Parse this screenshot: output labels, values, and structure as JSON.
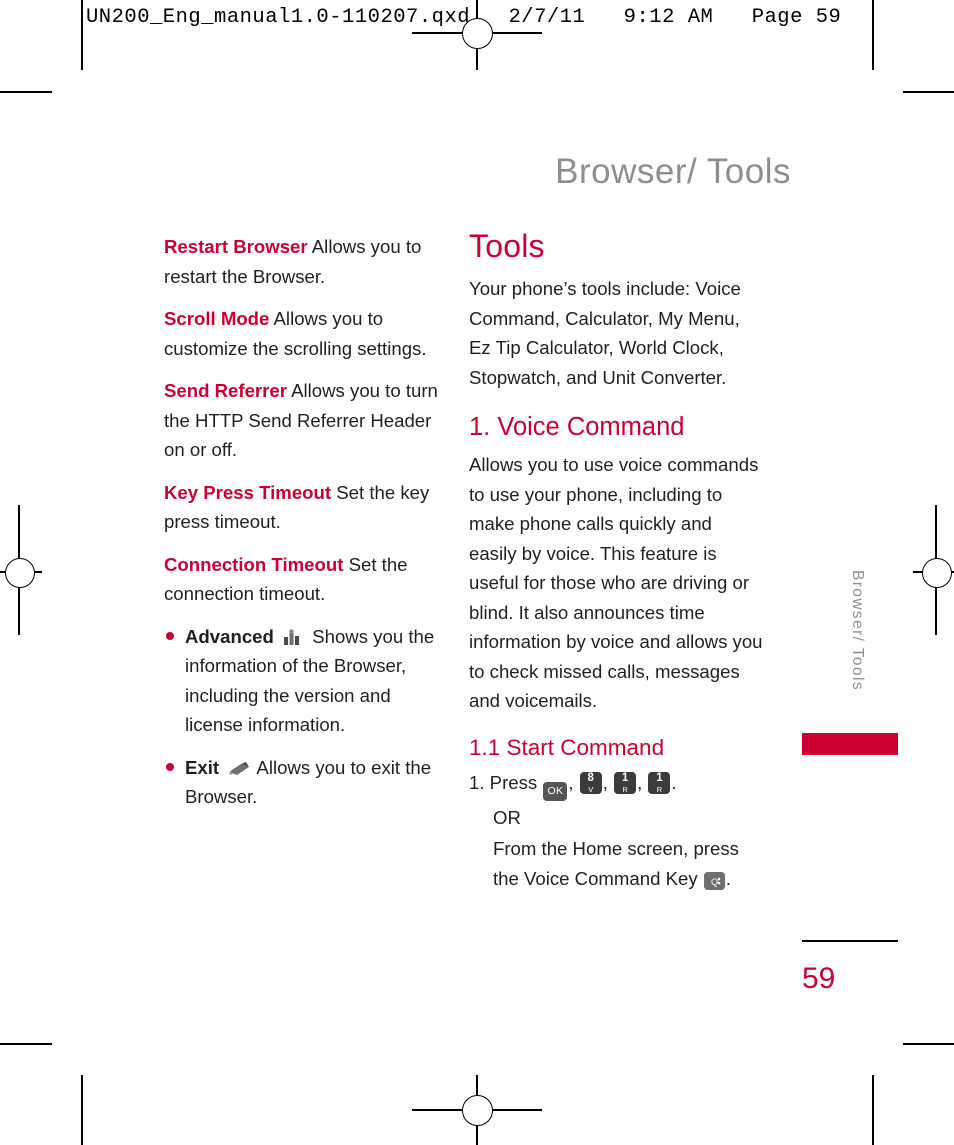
{
  "header": {
    "strip_text": "UN200_Eng_manual1.0-110207.qxd   2/7/11   9:12 AM   Page 59"
  },
  "chapter": {
    "title": "Browser/ Tools",
    "side_tab_label": "Browser/ Tools",
    "page_number": "59"
  },
  "left_column": {
    "entries": [
      {
        "term": "Restart Browser",
        "text": " Allows you to restart the Browser."
      },
      {
        "term": "Scroll Mode",
        "text": " Allows you to customize the scrolling settings."
      },
      {
        "term": "Send Referrer",
        "text": " Allows you to turn the HTTP Send Referrer Header on or off."
      },
      {
        "term": "Key Press Timeout",
        "text": " Set the key press timeout."
      },
      {
        "term": "Connection Timeout",
        "text": " Set the connection timeout."
      }
    ],
    "bullets": [
      {
        "term": "Advanced",
        "icon": "advanced-gear-icon",
        "text": " Shows you the information of the Browser, including the version and license information."
      },
      {
        "term": "Exit",
        "icon": "exit-arrow-icon",
        "text": " Allows you to exit the Browser."
      }
    ]
  },
  "right_column": {
    "tools_heading": "Tools",
    "tools_intro": "Your phone’s tools include: Voice Command, Calculator, My Menu, Ez Tip Calculator, World Clock, Stopwatch, and Unit Converter.",
    "voice_command_heading": "1. Voice Command",
    "voice_command_body": "Allows you to use voice commands to use your phone, including to make phone calls quickly and easily by voice. This feature is useful for those who are driving or blind. It also announces time information by voice and allows you to check missed calls, messages and voicemails.",
    "start_command_heading": "1.1 Start Command",
    "steps": [
      {
        "prefix": "1. Press",
        "keys": [
          "OK",
          "8",
          "1",
          "1"
        ],
        "key_sublabels": [
          "",
          "V",
          "R",
          "R"
        ],
        "suffix": "."
      },
      {
        "text": "OR"
      },
      {
        "text": "From the Home screen, press the Voice Command Key",
        "key_icon": "voice-command-key-icon",
        "suffix": "."
      }
    ]
  },
  "colors": {
    "accent_red": "#cc0033",
    "grey_heading": "#8e8e8e",
    "body_text": "#211f1f"
  }
}
